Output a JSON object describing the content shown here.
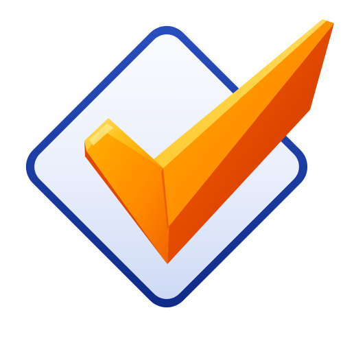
{
  "icon": {
    "name": "checkmark-icon",
    "description_label": "",
    "colors": {
      "background": "#ffffff",
      "diamond_border": "#1d3fa8",
      "diamond_border_dark": "#0f2a86",
      "diamond_fill_light": "#fbfcff",
      "diamond_fill_mid": "#e6ecfb",
      "diamond_fill_edge": "#c9d5f3",
      "check_highlight": "#ffe066",
      "check_light": "#ffc21a",
      "check_mid": "#ff9a00",
      "check_dark": "#e84a00",
      "check_shadow_red": "#c42a00"
    }
  }
}
